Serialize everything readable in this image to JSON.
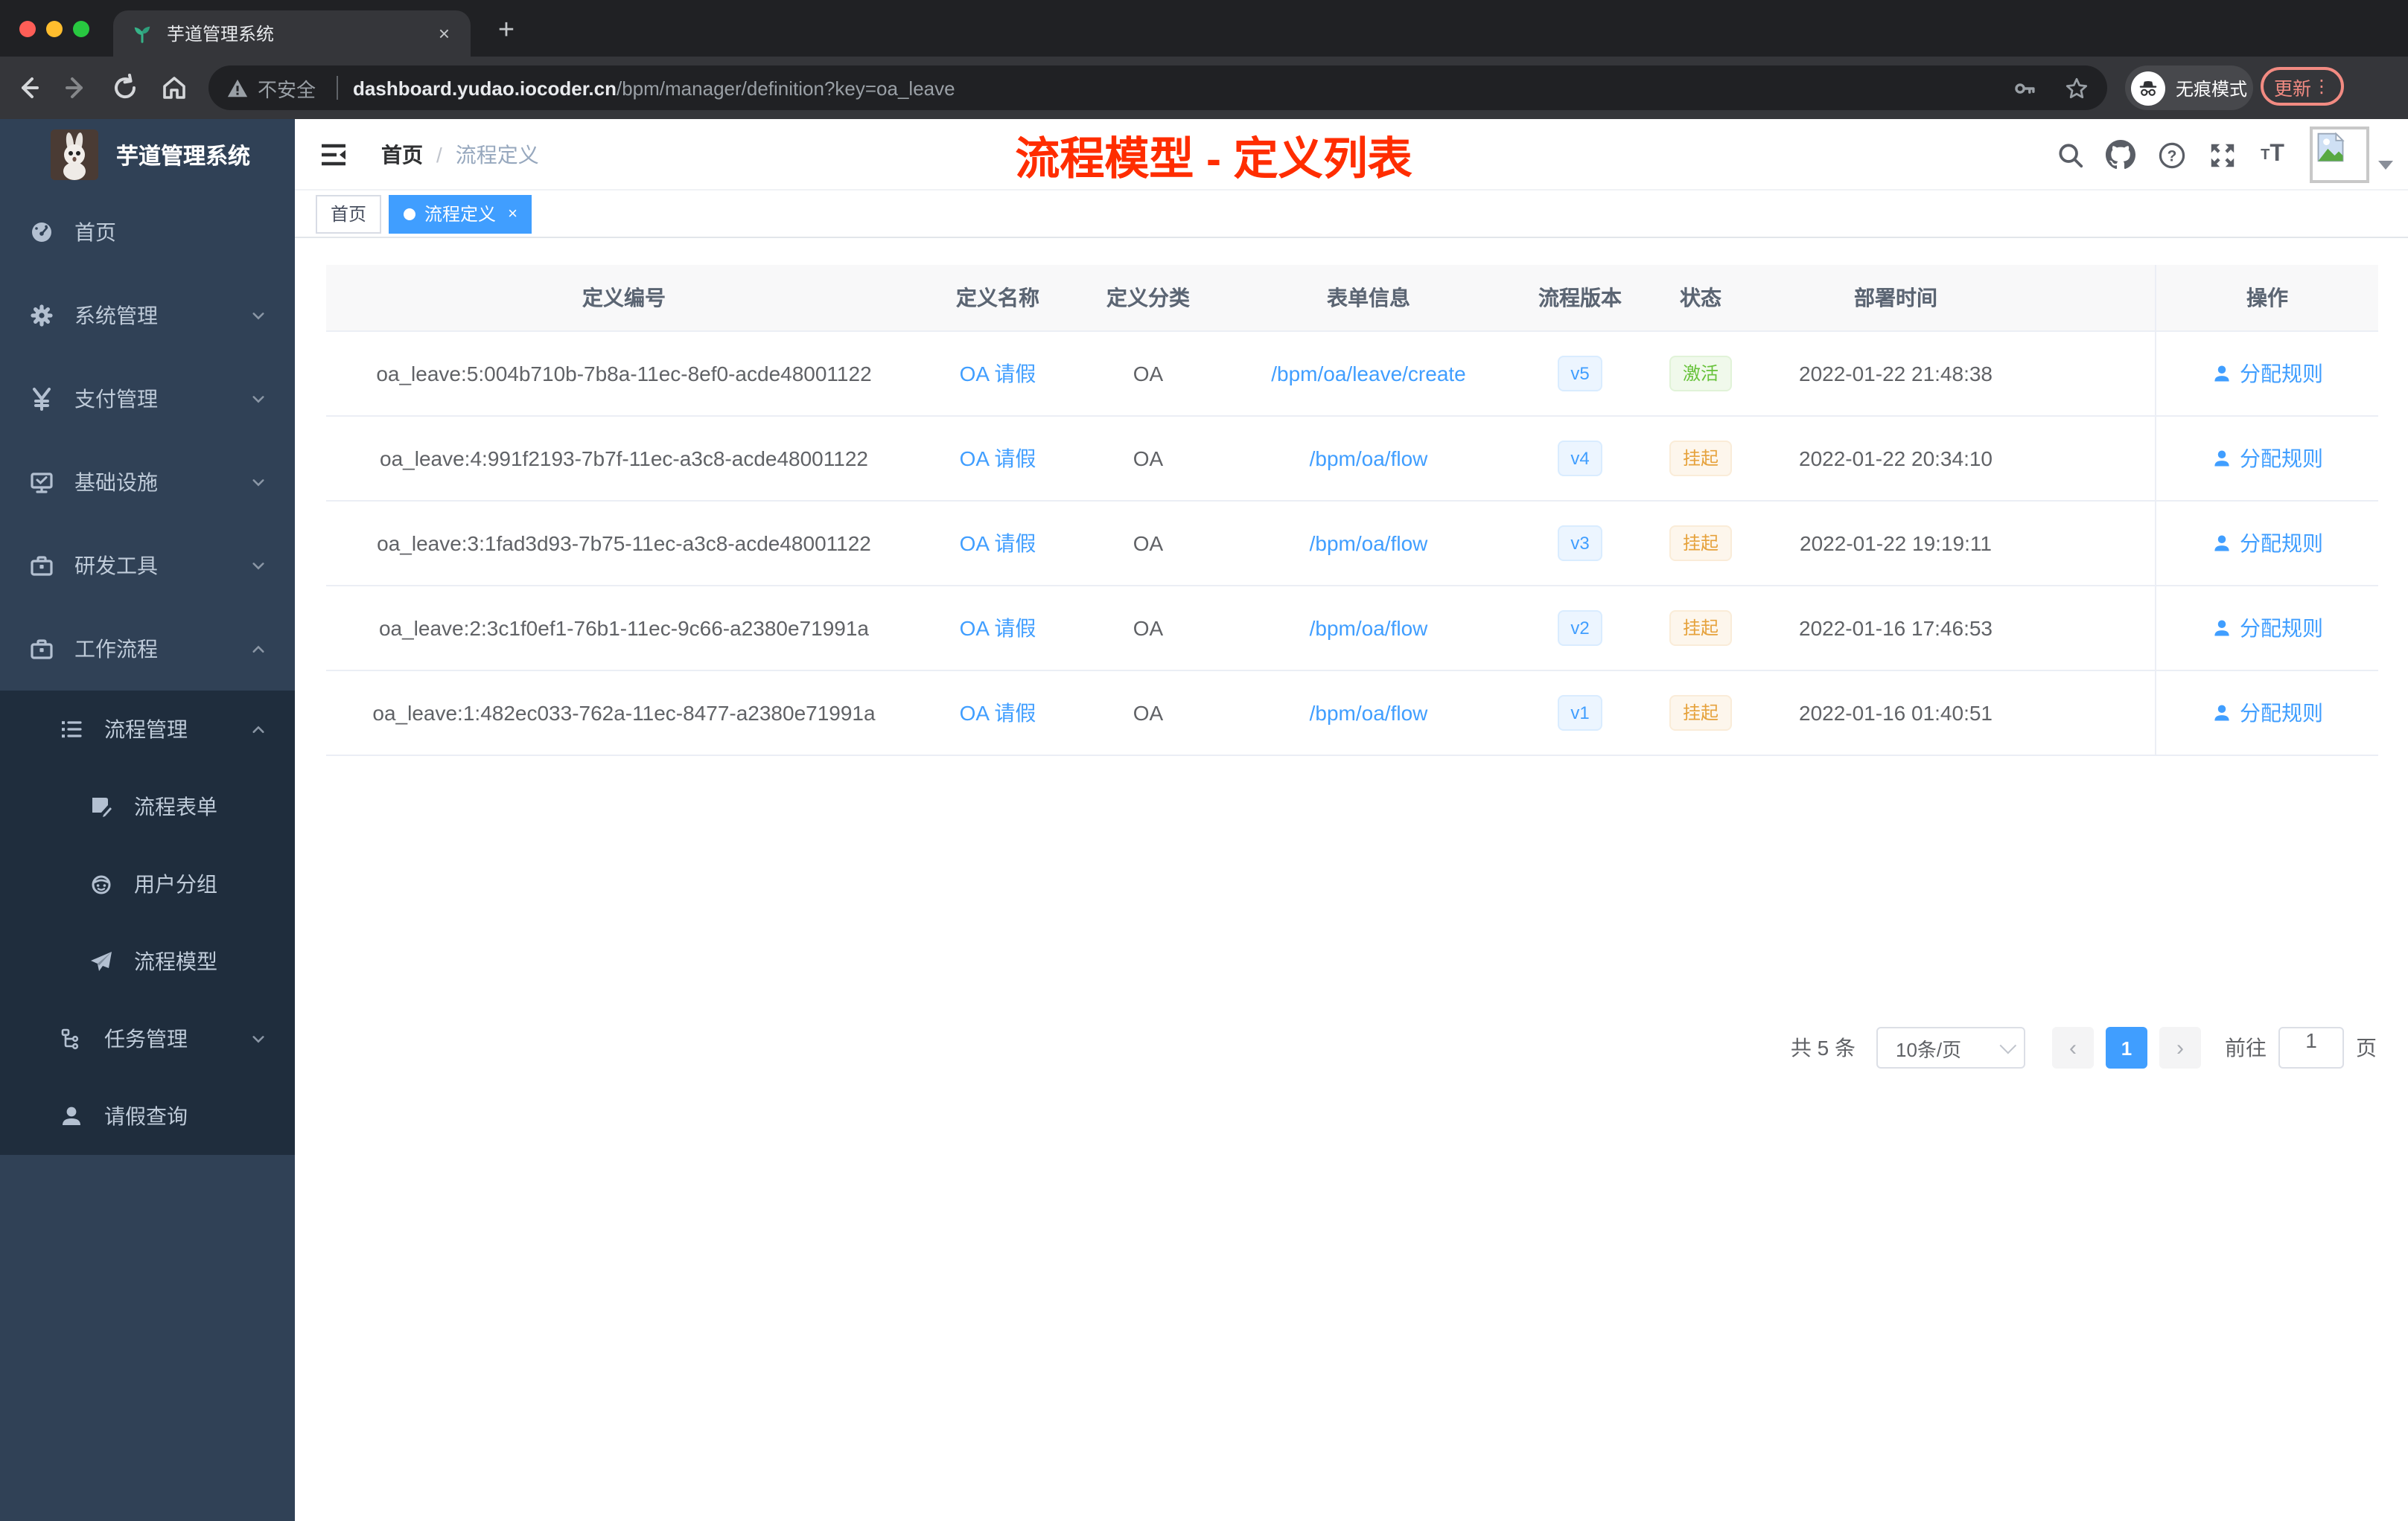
{
  "browser": {
    "tab_title": "芋道管理系统",
    "tab_close": "×",
    "new_tab": "+",
    "security_warning": "不安全",
    "url_host": "dashboard.yudao.iocoder.cn",
    "url_path": "/bpm/manager/definition?key=oa_leave",
    "incognito_label": "无痕模式",
    "update_label": "更新",
    "menu_dots": "⋮"
  },
  "sidebar": {
    "logo_title": "芋道管理系统",
    "items": [
      {
        "label": "首页",
        "icon": "dashboard-icon"
      },
      {
        "label": "系统管理",
        "icon": "gear-icon"
      },
      {
        "label": "支付管理",
        "icon": "yen-icon"
      },
      {
        "label": "基础设施",
        "icon": "monitor-icon"
      },
      {
        "label": "研发工具",
        "icon": "toolbox-icon"
      },
      {
        "label": "工作流程",
        "icon": "briefcase-icon"
      }
    ],
    "submenu": [
      {
        "label": "流程管理",
        "icon": "list-icon"
      },
      {
        "label": "流程表单",
        "icon": "form-icon"
      },
      {
        "label": "用户分组",
        "icon": "robot-icon"
      },
      {
        "label": "流程模型",
        "icon": "send-icon"
      },
      {
        "label": "任务管理",
        "icon": "tree-icon"
      },
      {
        "label": "请假查询",
        "icon": "user-icon"
      }
    ]
  },
  "navbar": {
    "breadcrumb_home": "首页",
    "breadcrumb_sep": "/",
    "breadcrumb_current": "流程定义",
    "annotation": "流程模型 - 定义列表",
    "font_size_icon_text": "TT"
  },
  "tags": {
    "home": "首页",
    "current": "流程定义",
    "current_close": "×"
  },
  "table": {
    "columns": [
      "定义编号",
      "定义名称",
      "定义分类",
      "表单信息",
      "流程版本",
      "状态",
      "部署时间",
      "操作"
    ],
    "rows": [
      {
        "id": "oa_leave:5:004b710b-7b8a-11ec-8ef0-acde48001122",
        "name": "OA 请假",
        "category": "OA",
        "form": "/bpm/oa/leave/create",
        "version": "v5",
        "status": "激活",
        "status_type": "active",
        "time": "2022-01-22 21:48:38",
        "action": "分配规则"
      },
      {
        "id": "oa_leave:4:991f2193-7b7f-11ec-a3c8-acde48001122",
        "name": "OA 请假",
        "category": "OA",
        "form": "/bpm/oa/flow",
        "version": "v4",
        "status": "挂起",
        "status_type": "suspended",
        "time": "2022-01-22 20:34:10",
        "action": "分配规则"
      },
      {
        "id": "oa_leave:3:1fad3d93-7b75-11ec-a3c8-acde48001122",
        "name": "OA 请假",
        "category": "OA",
        "form": "/bpm/oa/flow",
        "version": "v3",
        "status": "挂起",
        "status_type": "suspended",
        "time": "2022-01-22 19:19:11",
        "action": "分配规则"
      },
      {
        "id": "oa_leave:2:3c1f0ef1-76b1-11ec-9c66-a2380e71991a",
        "name": "OA 请假",
        "category": "OA",
        "form": "/bpm/oa/flow",
        "version": "v2",
        "status": "挂起",
        "status_type": "suspended",
        "time": "2022-01-16 17:46:53",
        "action": "分配规则"
      },
      {
        "id": "oa_leave:1:482ec033-762a-11ec-8477-a2380e71991a",
        "name": "OA 请假",
        "category": "OA",
        "form": "/bpm/oa/flow",
        "version": "v1",
        "status": "挂起",
        "status_type": "suspended",
        "time": "2022-01-16 01:40:51",
        "action": "分配规则"
      }
    ]
  },
  "pagination": {
    "total": "共 5 条",
    "page_size": "10条/页",
    "prev": "‹",
    "current_page": "1",
    "next": "›",
    "jumper_prefix": "前往",
    "jumper_value": "1",
    "jumper_suffix": "页"
  },
  "colors": {
    "accent_blue": "#409eff",
    "annotation_red": "#ff2d00",
    "status_active_green": "#67c23a",
    "status_suspended_orange": "#e6a23c",
    "sidebar_bg": "#304156",
    "submenu_bg": "#1f2d3d"
  }
}
